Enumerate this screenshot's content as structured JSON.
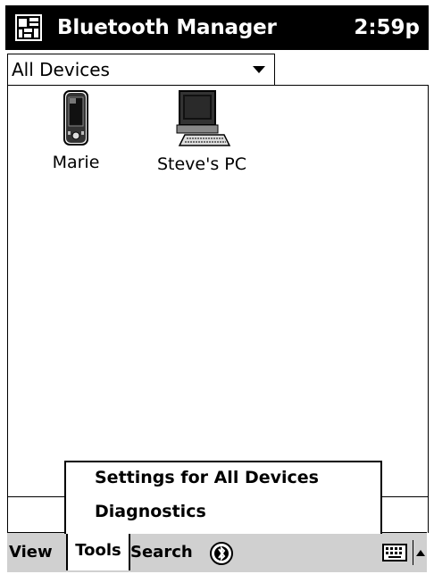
{
  "titlebar": {
    "title": "Bluetooth Manager",
    "clock": "2:59p"
  },
  "filter": {
    "selected": "All Devices"
  },
  "devices": [
    {
      "label": "Marie",
      "icon": "pda-icon"
    },
    {
      "label": "Steve's PC",
      "icon": "desktop-computer-icon"
    }
  ],
  "popup_menu": {
    "items": [
      "Settings for All Devices",
      "Diagnostics"
    ]
  },
  "command_bar": {
    "view": "View",
    "tools": "Tools",
    "search": "Search",
    "icons": [
      "bluetooth-icon",
      "keyboard-icon",
      "input-arrow-icon"
    ]
  }
}
